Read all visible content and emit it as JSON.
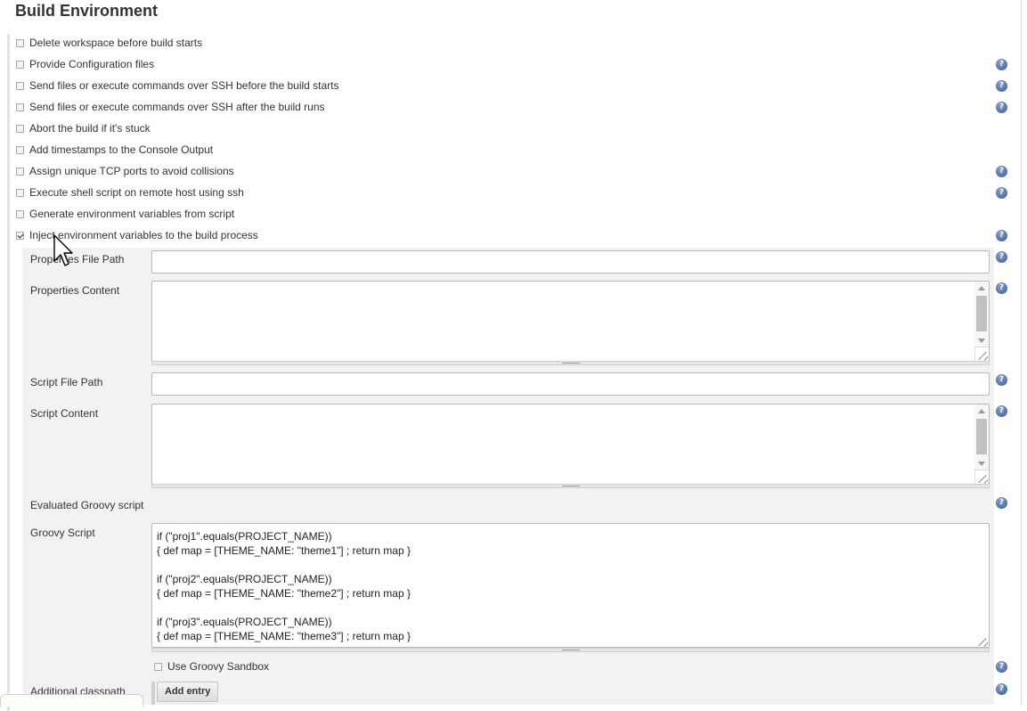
{
  "section": {
    "title": "Build Environment"
  },
  "options": [
    {
      "label": "Delete workspace before build starts",
      "checked": false,
      "help": false
    },
    {
      "label": "Provide Configuration files",
      "checked": false,
      "help": true
    },
    {
      "label": "Send files or execute commands over SSH before the build starts",
      "checked": false,
      "help": true
    },
    {
      "label": "Send files or execute commands over SSH after the build runs",
      "checked": false,
      "help": true
    },
    {
      "label": "Abort the build if it's stuck",
      "checked": false,
      "help": false
    },
    {
      "label": "Add timestamps to the Console Output",
      "checked": false,
      "help": false
    },
    {
      "label": "Assign unique TCP ports to avoid collisions",
      "checked": false,
      "help": true
    },
    {
      "label": "Execute shell script on remote host using ssh",
      "checked": false,
      "help": true
    },
    {
      "label": "Generate environment variables from script",
      "checked": false,
      "help": false
    },
    {
      "label": "Inject environment variables to the build process",
      "checked": true,
      "help": true
    }
  ],
  "inject": {
    "properties_file_path_label": "Properties File Path",
    "properties_file_path_value": "",
    "properties_content_label": "Properties Content",
    "properties_content_value": "",
    "script_file_path_label": "Script File Path",
    "script_file_path_value": "",
    "script_content_label": "Script Content",
    "script_content_value": "",
    "evaluated_groovy_label": "Evaluated Groovy script",
    "groovy_script_label": "Groovy Script",
    "groovy_lines": [
      "if (\"proj1\".equals(PROJECT_NAME))",
      "{ def map = [THEME_NAME: \"theme1\"] ; return map }",
      "",
      "if (\"proj2\".equals(PROJECT_NAME))",
      "{ def map = [THEME_NAME: \"theme2\"] ; return map }",
      "",
      "if (\"proj3\".equals(PROJECT_NAME))",
      "{ def map = [THEME_NAME: \"theme3\"] ; return map }"
    ],
    "use_groovy_sandbox_label": "Use Groovy Sandbox",
    "use_groovy_sandbox_checked": false,
    "additional_classpath_label": "Additional classpath",
    "add_entry_label": "Add entry"
  },
  "help_glyph": "?",
  "icons": {
    "help": "help-icon",
    "cursor": "mouse-pointer-icon",
    "check": "checkmark-icon"
  },
  "colors": {
    "help_icon": "#4e6ea6",
    "panel_bg": "#f2f2f2",
    "border": "#b9b9b9"
  }
}
